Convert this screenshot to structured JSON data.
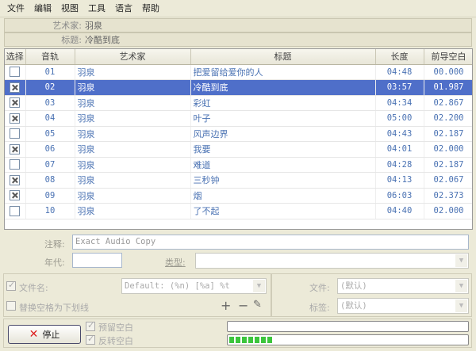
{
  "menu": [
    "文件",
    "编辑",
    "视图",
    "工具",
    "语言",
    "帮助"
  ],
  "info": {
    "artist_label": "艺术家:",
    "artist_value": "羽泉",
    "title_label": "标题:",
    "title_value": "冷酷到底"
  },
  "columns": [
    "选择",
    "音轨",
    "艺术家",
    "标题",
    "长度",
    "前导空白"
  ],
  "tracks": [
    {
      "checked": false,
      "track": "01",
      "artist": "羽泉",
      "title": "把爱留给爱你的人",
      "length": "04:48",
      "pregap": "00.000",
      "selected": false
    },
    {
      "checked": true,
      "track": "02",
      "artist": "羽泉",
      "title": "冷酷到底",
      "length": "03:57",
      "pregap": "01.987",
      "selected": true
    },
    {
      "checked": true,
      "track": "03",
      "artist": "羽泉",
      "title": "彩虹",
      "length": "04:34",
      "pregap": "02.867",
      "selected": false
    },
    {
      "checked": true,
      "track": "04",
      "artist": "羽泉",
      "title": "叶子",
      "length": "05:00",
      "pregap": "02.200",
      "selected": false
    },
    {
      "checked": false,
      "track": "05",
      "artist": "羽泉",
      "title": "风声边界",
      "length": "04:43",
      "pregap": "02.187",
      "selected": false
    },
    {
      "checked": true,
      "track": "06",
      "artist": "羽泉",
      "title": "我要",
      "length": "04:01",
      "pregap": "02.000",
      "selected": false
    },
    {
      "checked": false,
      "track": "07",
      "artist": "羽泉",
      "title": "难道",
      "length": "04:28",
      "pregap": "02.187",
      "selected": false
    },
    {
      "checked": true,
      "track": "08",
      "artist": "羽泉",
      "title": "三秒钟",
      "length": "04:13",
      "pregap": "02.067",
      "selected": false
    },
    {
      "checked": true,
      "track": "09",
      "artist": "羽泉",
      "title": "烟",
      "length": "06:03",
      "pregap": "02.373",
      "selected": false
    },
    {
      "checked": false,
      "track": "10",
      "artist": "羽泉",
      "title": "了不起",
      "length": "04:40",
      "pregap": "02.000",
      "selected": false
    }
  ],
  "comment_label": "注释:",
  "comment_value": "Exact Audio Copy",
  "year_label": "年代:",
  "year_value": "",
  "genre_label": "类型:",
  "genre_value": "",
  "filename_label": "文件名:",
  "filename_pattern": "Default: (%n) [%a] %t",
  "replace_spaces_label": "替换空格为下划线",
  "file_label": "文件:",
  "file_value": "(默认)",
  "tag_label": "标签:",
  "tag_value": "(默认)",
  "stop_label": "停止",
  "preserve_gap_label": "预留空白",
  "reverse_gap_label": "反转空白",
  "progress_fraction": 0.17,
  "progress_segments": 7
}
